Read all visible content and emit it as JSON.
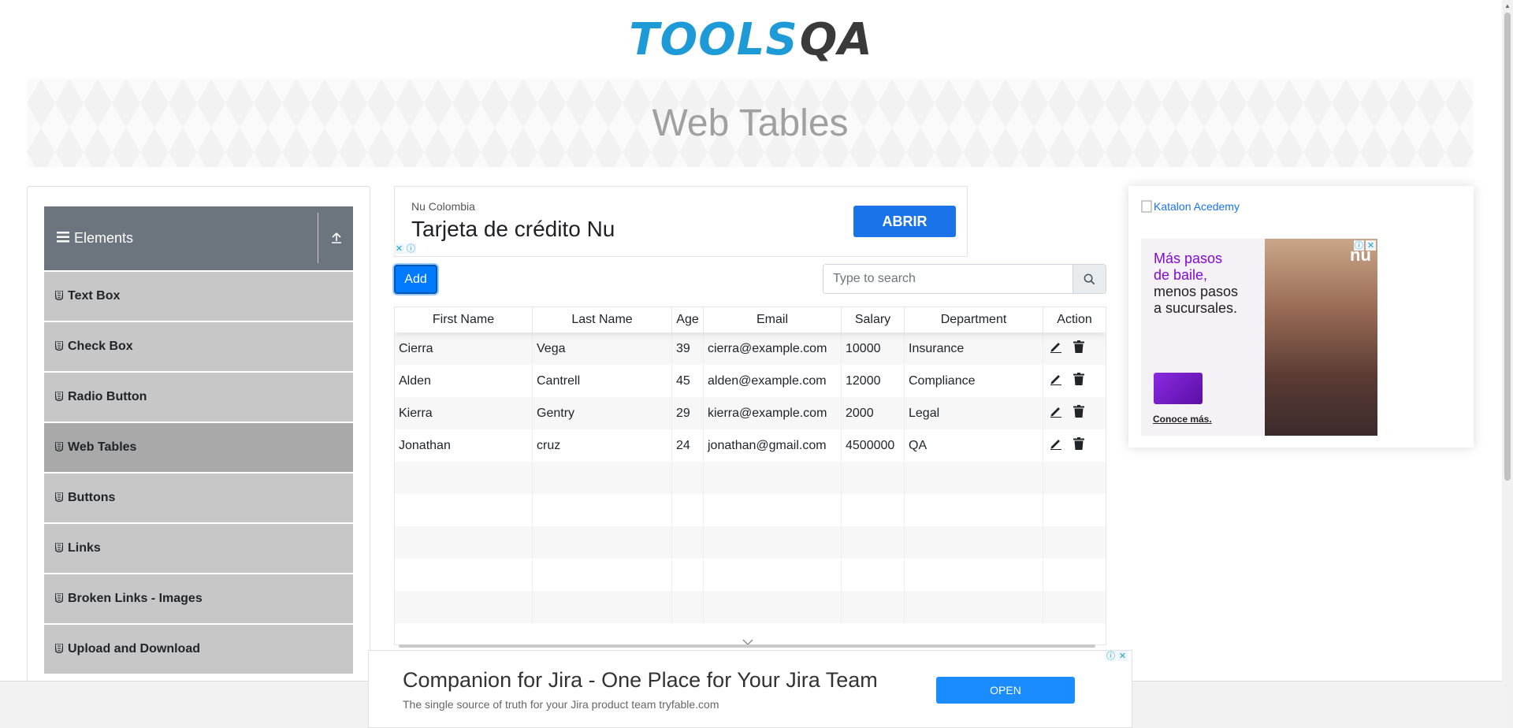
{
  "header": {
    "logo_tools": "TOOLS",
    "logo_qa": "QA",
    "page_title": "Web Tables"
  },
  "sidebar": {
    "group_title": "Elements",
    "items": [
      {
        "label": "Text Box",
        "active": false
      },
      {
        "label": "Check Box",
        "active": false
      },
      {
        "label": "Radio Button",
        "active": false
      },
      {
        "label": "Web Tables",
        "active": true
      },
      {
        "label": "Buttons",
        "active": false
      },
      {
        "label": "Links",
        "active": false
      },
      {
        "label": "Broken Links - Images",
        "active": false
      },
      {
        "label": "Upload and Download",
        "active": false
      }
    ]
  },
  "ad_top": {
    "advertiser": "Nu Colombia",
    "headline": "Tarjeta de crédito Nu",
    "cta": "ABRIR"
  },
  "controls": {
    "add_label": "Add",
    "search_placeholder": "Type to search"
  },
  "table": {
    "columns": [
      "First Name",
      "Last Name",
      "Age",
      "Email",
      "Salary",
      "Department",
      "Action"
    ],
    "rows": [
      [
        "Cierra",
        "Vega",
        "39",
        "cierra@example.com",
        "10000",
        "Insurance"
      ],
      [
        "Alden",
        "Cantrell",
        "45",
        "alden@example.com",
        "12000",
        "Compliance"
      ],
      [
        "Kierra",
        "Gentry",
        "29",
        "kierra@example.com",
        "2000",
        "Legal"
      ],
      [
        "Jonathan",
        "cruz",
        "24",
        "jonathan@gmail.com",
        "4500000",
        "QA"
      ],
      [
        "",
        "",
        "",
        "",
        "",
        ""
      ],
      [
        "",
        "",
        "",
        "",
        "",
        ""
      ],
      [
        "",
        "",
        "",
        "",
        "",
        ""
      ],
      [
        "",
        "",
        "",
        "",
        "",
        ""
      ],
      [
        "",
        "",
        "",
        "",
        "",
        ""
      ]
    ]
  },
  "ad_right": {
    "broken_image_alt": "Katalon Acedemy",
    "line1": "Más pasos",
    "line2": "de baile,",
    "line3": "menos pasos",
    "line4": "a sucursales.",
    "link": "Conoce más.",
    "brand": "nu"
  },
  "ad_bottom": {
    "headline": "Companion for Jira - One Place for Your Jira Team",
    "sub": "The single source of truth for your Jira product team tryfable.com",
    "cta": "OPEN"
  },
  "colors": {
    "primary": "#007bff",
    "sidebar_header": "#6c757d",
    "sidebar_item": "#c7c7c7",
    "sidebar_active": "#a9a9a9",
    "logo_blue": "#1e9ad6"
  }
}
